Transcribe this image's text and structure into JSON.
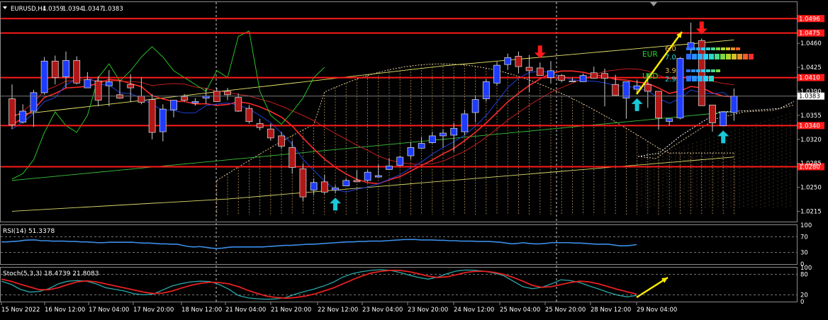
{
  "title": "EURUSD,H4",
  "ohlc": {
    "open": "1.0359",
    "high": "1.0394",
    "low": "1.0347",
    "close": "1.0383"
  },
  "colors": {
    "background": "#000000",
    "bull_body": "#1e3cff",
    "bear_body": "#b01818",
    "level_line": "#ff1a1a",
    "down_arrow": "#ff1a1a",
    "up_arrow": "#18c8d8",
    "signal_arrow": "#ffee00",
    "rsi_line": "#3a8ee8",
    "stoch_main": "#2aa8a8",
    "stoch_signal": "#e82020"
  },
  "chart_data": [
    {
      "type": "candlestick",
      "symbol": "EURUSD",
      "timeframe": "H4",
      "ylim": [
        1.02,
        1.052
      ],
      "y_ticks": [
        "1.0460",
        "1.0425",
        "1.0390",
        "1.0355",
        "1.0320",
        "1.0285",
        "1.0250",
        "1.0215"
      ],
      "current_price": "1.0383",
      "levels": [
        "1.0496",
        "1.0475",
        "1.0410",
        "1.0340",
        "1.0280"
      ],
      "candles": [
        [
          1.0379,
          1.04,
          1.0335,
          1.0341
        ],
        [
          1.0345,
          1.0371,
          1.0343,
          1.0361
        ],
        [
          1.0361,
          1.0392,
          1.0338,
          1.0388
        ],
        [
          1.0388,
          1.044,
          1.0385,
          1.0434
        ],
        [
          1.0434,
          1.0442,
          1.04,
          1.041
        ],
        [
          1.0411,
          1.0448,
          1.0395,
          1.0435
        ],
        [
          1.0435,
          1.0441,
          1.04,
          1.0402
        ],
        [
          1.0395,
          1.0418,
          1.0396,
          1.0407
        ],
        [
          1.0405,
          1.0412,
          1.0368,
          1.0377
        ],
        [
          1.0398,
          1.0421,
          1.0368,
          1.0404
        ],
        [
          1.0385,
          1.0406,
          1.0379,
          1.038
        ],
        [
          1.04,
          1.0415,
          1.0374,
          1.0395
        ],
        [
          1.0383,
          1.041,
          1.0371,
          1.0374
        ],
        [
          1.0378,
          1.0386,
          1.032,
          1.033
        ],
        [
          1.0331,
          1.0371,
          1.0317,
          1.0364
        ],
        [
          1.0363,
          1.037,
          1.0352,
          1.0377
        ],
        [
          1.0382,
          1.0386,
          1.0375,
          1.0377
        ],
        [
          1.0373,
          1.038,
          1.0369,
          1.0375
        ],
        [
          1.038,
          1.0395,
          1.0372,
          1.0383
        ],
        [
          1.039,
          1.0395,
          1.0377,
          1.0375
        ],
        [
          1.039,
          1.0395,
          1.0377,
          1.0385
        ],
        [
          1.0381,
          1.0387,
          1.036,
          1.0361
        ],
        [
          1.0365,
          1.037,
          1.0343,
          1.0346
        ],
        [
          1.0343,
          1.035,
          1.0333,
          1.0337
        ],
        [
          1.0335,
          1.0343,
          1.0318,
          1.0322
        ],
        [
          1.0325,
          1.0331,
          1.0306,
          1.031
        ],
        [
          1.0308,
          1.0318,
          1.027,
          1.0279
        ],
        [
          1.0277,
          1.0285,
          1.023,
          1.0236
        ],
        [
          1.0246,
          1.0263,
          1.0239,
          1.0257
        ],
        [
          1.0258,
          1.0268,
          1.024,
          1.0243
        ],
        [
          1.0246,
          1.0253,
          1.0241,
          1.0249
        ],
        [
          1.0252,
          1.0263,
          1.0254,
          1.026
        ],
        [
          1.026,
          1.0275,
          1.026,
          1.0258
        ],
        [
          1.026,
          1.0275,
          1.0258,
          1.0272
        ],
        [
          1.0265,
          1.0283,
          1.0265,
          1.0267
        ],
        [
          1.0276,
          1.0292,
          1.0276,
          1.0281
        ],
        [
          1.0282,
          1.0296,
          1.0281,
          1.0294
        ],
        [
          1.0296,
          1.0316,
          1.0291,
          1.0308
        ],
        [
          1.0307,
          1.0323,
          1.0306,
          1.0314
        ],
        [
          1.0315,
          1.0331,
          1.0314,
          1.0325
        ],
        [
          1.0325,
          1.0335,
          1.0308,
          1.0329
        ],
        [
          1.0326,
          1.0344,
          1.0302,
          1.0336
        ],
        [
          1.0331,
          1.0363,
          1.0326,
          1.0357
        ],
        [
          1.0359,
          1.0384,
          1.0345,
          1.0378
        ],
        [
          1.0379,
          1.0408,
          1.0375,
          1.0404
        ],
        [
          1.0402,
          1.0433,
          1.0398,
          1.0428
        ],
        [
          1.0429,
          1.0445,
          1.0421,
          1.0439
        ],
        [
          1.0441,
          1.0448,
          1.0416,
          1.0426
        ],
        [
          1.0425,
          1.0443,
          1.0389,
          1.042
        ],
        [
          1.0424,
          1.0432,
          1.0413,
          1.0413
        ],
        [
          1.041,
          1.0434,
          1.0401,
          1.042
        ],
        [
          1.0413,
          1.0415,
          1.0403,
          1.0406
        ],
        [
          1.0404,
          1.041,
          1.0404,
          1.0405
        ],
        [
          1.0404,
          1.0416,
          1.0404,
          1.0413
        ],
        [
          1.0417,
          1.0426,
          1.0411,
          1.0409
        ],
        [
          1.0416,
          1.0423,
          1.0368,
          1.0409
        ],
        [
          1.04,
          1.0414,
          1.0394,
          1.0384
        ],
        [
          1.038,
          1.039,
          1.035,
          1.0404
        ],
        [
          1.0393,
          1.0407,
          1.0386,
          1.0398
        ],
        [
          1.04,
          1.0416,
          1.0366,
          1.039
        ],
        [
          1.039,
          1.039,
          1.0334,
          1.0351
        ],
        [
          1.0346,
          1.035,
          1.034,
          1.035
        ],
        [
          1.0351,
          1.044,
          1.0349,
          1.0438
        ],
        [
          1.0451,
          1.049,
          1.0444,
          1.0461
        ],
        [
          1.0464,
          1.0467,
          1.037,
          1.0369
        ],
        [
          1.037,
          1.037,
          1.0331,
          1.0344
        ],
        [
          1.034,
          1.0361,
          1.0339,
          1.036
        ],
        [
          1.0359,
          1.0394,
          1.0347,
          1.0383
        ]
      ],
      "up_arrow_candles": [
        30,
        58,
        66
      ],
      "down_arrow_candles": [
        49,
        64
      ]
    },
    {
      "type": "line",
      "title": "RSI(14) 51.3378",
      "ylim": [
        0,
        100
      ],
      "y_ticks": [
        "100",
        "70",
        "30",
        "0"
      ],
      "values": [
        57,
        57,
        58,
        59,
        61,
        62,
        62,
        60,
        60,
        59,
        59,
        59,
        58,
        58,
        57,
        57,
        56,
        55,
        55,
        56,
        56,
        56,
        56,
        56,
        55,
        54,
        54,
        53,
        52,
        52,
        51,
        51,
        48,
        45,
        44,
        45,
        43,
        41,
        40,
        41,
        43,
        44,
        44,
        44,
        44,
        44,
        44,
        45,
        46,
        47,
        48,
        48,
        49,
        50,
        51,
        51,
        52,
        53,
        54,
        55,
        56,
        57,
        57,
        58,
        58,
        59,
        59,
        59,
        60,
        61,
        62,
        63,
        63,
        63,
        62,
        62,
        62,
        61,
        61,
        60,
        60,
        59,
        59,
        59,
        58,
        58,
        58,
        57,
        56,
        54,
        52,
        53,
        55,
        53,
        52,
        52,
        53,
        55,
        55,
        55,
        55,
        54,
        54,
        53,
        52,
        51,
        51,
        51,
        49,
        47,
        47,
        48,
        50
      ]
    },
    {
      "type": "line",
      "title": "Stoch(5,3,3) 18.4739 21.8083",
      "ylim": [
        0,
        100
      ],
      "y_ticks": [
        "100",
        "80",
        "20",
        "0"
      ],
      "series": [
        {
          "values": [
            60,
            51,
            36,
            28,
            30,
            38,
            52,
            60,
            62,
            60,
            52,
            41,
            36,
            31,
            23,
            20,
            22,
            34,
            46,
            53,
            58,
            60,
            59,
            50,
            36,
            18,
            11,
            8,
            7,
            8,
            12,
            22,
            30,
            37,
            46,
            57,
            72,
            82,
            88,
            92,
            94,
            92,
            86,
            78,
            71,
            66,
            72,
            82,
            90,
            93,
            92,
            89,
            84,
            76,
            60,
            44,
            38,
            42,
            52,
            64,
            62,
            56,
            46,
            37,
            27,
            19,
            14,
            18
          ]
        },
        {
          "values": [
            66,
            60,
            51,
            43,
            35,
            35,
            41,
            50,
            58,
            61,
            58,
            52,
            46,
            40,
            34,
            28,
            24,
            25,
            31,
            40,
            48,
            54,
            57,
            56,
            52,
            44,
            33,
            24,
            16,
            12,
            10,
            12,
            16,
            22,
            31,
            40,
            52,
            64,
            75,
            84,
            89,
            92,
            92,
            88,
            82,
            75,
            71,
            73,
            79,
            86,
            89,
            89,
            86,
            80,
            71,
            60,
            48,
            42,
            44,
            50,
            56,
            60,
            58,
            52,
            44,
            36,
            29,
            22
          ]
        }
      ]
    }
  ],
  "time_labels": [
    "15 Nov 2022",
    "16 Nov 12:00",
    "17 Nov 04:00",
    "17 Nov 20:00",
    "18 Nov 12:00",
    "21 Nov 04:00",
    "21 Nov 20:00",
    "22 Nov 12:00",
    "23 Nov 04:00",
    "23 Nov 20:00",
    "24 Nov 12:00",
    "25 Nov 04:00",
    "25 Nov 20:00",
    "28 Nov 12:00",
    "29 Nov 04:00"
  ],
  "currency_strength": [
    {
      "name": "EUR",
      "value": "6.0",
      "value2": "7.0"
    },
    {
      "name": "USD",
      "value": "3.9",
      "value2": "2.9"
    }
  ]
}
